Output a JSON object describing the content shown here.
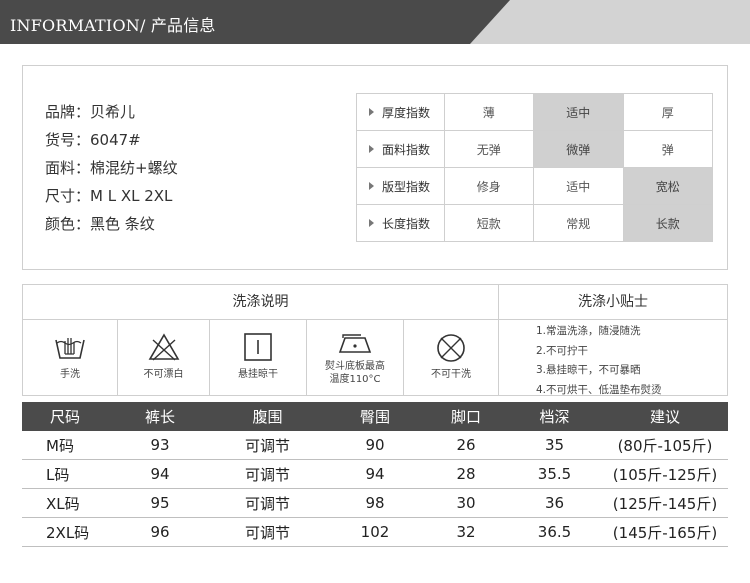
{
  "header": {
    "title": "INFORMATION/ 产品信息"
  },
  "specs": [
    "品牌：贝希儿",
    "货号：6047#",
    "面料：棉混纺+螺纹",
    "尺寸：M L XL 2XL",
    "颜色：黑色 条纹"
  ],
  "ratings": [
    {
      "label": "厚度指数",
      "options": [
        "薄",
        "适中",
        "厚"
      ],
      "selected_index": 1
    },
    {
      "label": "面料指数",
      "options": [
        "无弹",
        "微弹",
        "弹"
      ],
      "selected_index": 1
    },
    {
      "label": "版型指数",
      "options": [
        "修身",
        "适中",
        "宽松"
      ],
      "selected_index": 2
    },
    {
      "label": "长度指数",
      "options": [
        "短款",
        "常规",
        "长款"
      ],
      "selected_index": 2
    }
  ],
  "wash": {
    "title": "洗涤说明",
    "tips_title": "洗涤小贴士",
    "icons": [
      {
        "icon": "hand-wash-icon",
        "label": "手洗"
      },
      {
        "icon": "no-bleach-icon",
        "label": "不可漂白"
      },
      {
        "icon": "hang-dry-icon",
        "label": "悬挂晾干"
      },
      {
        "icon": "iron-icon",
        "label": "熨斗底板最高",
        "label2": "温度110°C"
      },
      {
        "icon": "no-dry-clean-icon",
        "label": "不可干洗"
      }
    ],
    "tips": [
      "1.常温洗涤，随浸随洗",
      "2.不可拧干",
      "3.悬挂晾干，不可暴晒",
      "4.不可烘干、低温垫布熨烫"
    ]
  },
  "size_table": {
    "headers": [
      "尺码",
      "裤长",
      "腹围",
      "臀围",
      "脚口",
      "档深",
      "建议"
    ],
    "rows": [
      [
        "M码",
        "93",
        "可调节",
        "90",
        "26",
        "35",
        "(80斤-105斤)"
      ],
      [
        "L码",
        "94",
        "可调节",
        "94",
        "28",
        "35.5",
        "(105斤-125斤)"
      ],
      [
        "XL码",
        "95",
        "可调节",
        "98",
        "30",
        "36",
        "(125斤-145斤)"
      ],
      [
        "2XL码",
        "96",
        "可调节",
        "102",
        "32",
        "36.5",
        "(145斤-165斤)"
      ]
    ]
  },
  "colors": {
    "header_dark": "#4a4a4a",
    "header_light": "#d3d3d3",
    "selected": "#d0d0d0",
    "table_header": "#4b4b4b"
  }
}
